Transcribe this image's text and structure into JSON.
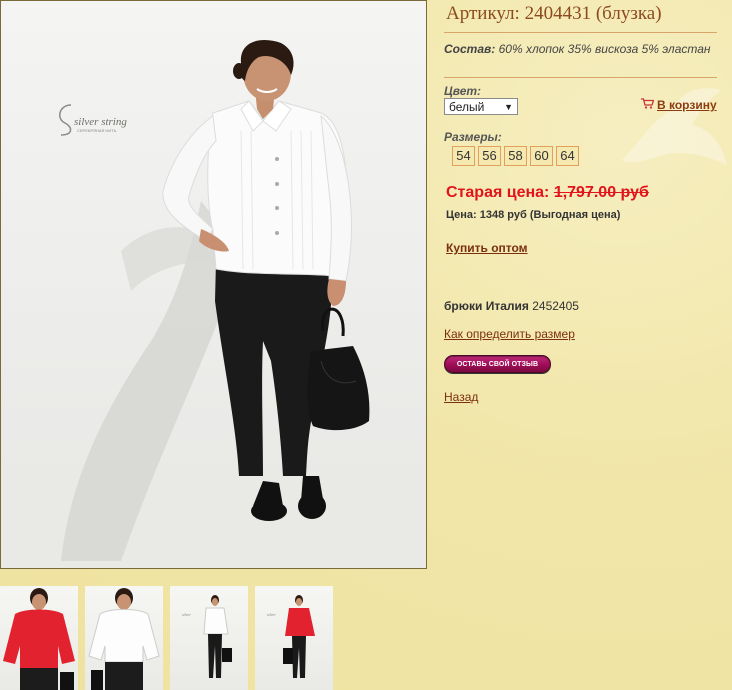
{
  "product": {
    "title": "Артикул: 2404431 (блузка)",
    "composition_label": "Состав:",
    "composition_value": " 60% хлопок 35% вискоза 5% эластан",
    "color_label": "Цвет:",
    "color_selected": "белый",
    "cart_label": "В корзину",
    "sizes_label": "Размеры:",
    "sizes": [
      "54",
      "56",
      "58",
      "60",
      "64"
    ],
    "old_price_label": "Старая цена: ",
    "old_price_value": "1,797.00 руб",
    "price_text": "Цена: 1348 руб (Выгодная цена)",
    "wholesale_link": "Купить оптом",
    "related_name": "брюки Италия",
    "related_code": " 2452405",
    "size_guide_link": "Как определить размер",
    "review_button": "ОСТАВЬ СВОЙ ОТЗЫВ",
    "back_link": "Назад"
  },
  "photo": {
    "brand_name": "silver string",
    "brand_sub": "СЕРЕБРЯНАЯ НИТЬ"
  },
  "icons": {
    "cart": "shopping-cart-icon",
    "select_arrow": "triangle-down-icon"
  },
  "colors": {
    "background": "#f1e6a8",
    "title": "#8c4a1e",
    "old_price": "#e2141b",
    "link": "#7b2f0f",
    "review_button": "#a10f5a",
    "size_border": "#e1a05b"
  },
  "thumbnails": [
    {
      "alt": "red-blouse-thumb"
    },
    {
      "alt": "white-blouse-thumb"
    },
    {
      "alt": "white-blouse-full-thumb"
    },
    {
      "alt": "red-blouse-full-thumb"
    }
  ]
}
